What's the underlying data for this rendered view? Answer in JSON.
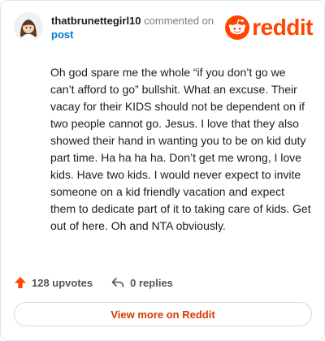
{
  "comment": {
    "author": "thatbrunettegirl10",
    "action": "commented on",
    "target": "post",
    "body": "Oh god spare me the whole “if you don’t go we can’t afford to go” bullshit. What an excuse. Their vacay for their KIDS should not be dependent on if two people cannot go. Jesus. I love that they also showed their hand in wanting you to be on kid duty part time. Ha ha ha ha. Don’t get me wrong, I love kids. Have two kids. I would never expect to invite someone on a kid friendly vacation and expect them to dedicate part of it to taking care of kids. Get out of here. Oh and NTA obviously."
  },
  "brand": {
    "wordmark": "reddit",
    "color": "#ff4500"
  },
  "stats": {
    "upvotes": "128 upvotes",
    "replies": "0 replies",
    "upvote_icon": "upvote-arrow-icon",
    "reply_icon": "reply-arrow-icon"
  },
  "cta": {
    "label": "View more on Reddit",
    "color": "#d93900"
  },
  "link_color": "#0079d3"
}
